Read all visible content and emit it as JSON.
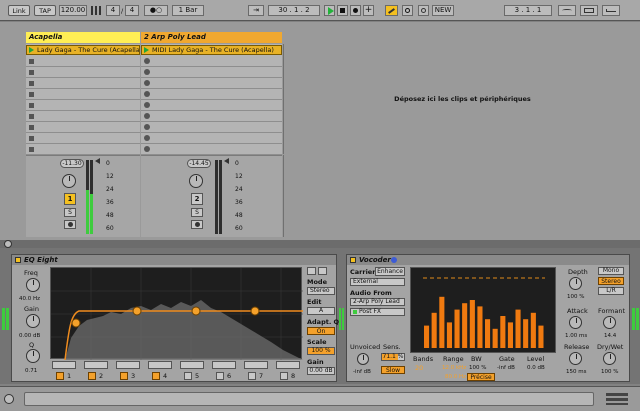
{
  "toolbar": {
    "link": "Link",
    "tap": "TAP",
    "tempo": "120.00",
    "sig_num": "4",
    "sig_den": "4",
    "metro": "●○",
    "quant": "1 Bar",
    "arrow": "⇥",
    "position": "30 . 1 . 2",
    "overdub_label": "NEW",
    "loop_pos": "3 . 1 . 1"
  },
  "tracks": [
    {
      "name": "Acapella",
      "clip": "Lady Gaga - The Cure (Acapella)",
      "volume": "-11.30",
      "number": "1",
      "solo": "S"
    },
    {
      "name": "2 Arp Poly Lead",
      "clip": "MIDI Lady Gaga - The Cure (Acapella)",
      "volume": "-14.45",
      "number": "2",
      "solo": "S"
    }
  ],
  "drop_zone": "Déposez ici les clips et périphériques",
  "meter_scale": [
    "0",
    "12",
    "24",
    "36",
    "48",
    "60"
  ],
  "eq": {
    "title": "EQ Eight",
    "freq_label": "Freq",
    "freq_value": "40.0 Hz",
    "gain_label": "Gain",
    "gain_value": "0.00 dB",
    "q_label": "Q",
    "q_value": "0.71",
    "mode_label": "Mode",
    "mode_value": "Stereo",
    "edit_label": "Edit",
    "edit_value": "A",
    "adapt_label": "Adapt. Q",
    "adapt_value": "On",
    "scale_label": "Scale",
    "scale_value": "100 %",
    "out_gain_label": "Gain",
    "out_gain_value": "0.00 dB",
    "bands": [
      "1",
      "2",
      "3",
      "4",
      "5",
      "6",
      "7",
      "8"
    ]
  },
  "vocoder": {
    "title": "Vocoder",
    "carrier_label": "Carrier",
    "enhance_label": "Enhance",
    "carrier_value": "External",
    "audio_from_label": "Audio From",
    "audio_from_value": "2-Arp Poly Lead",
    "post_fx": "Post FX",
    "unvoiced_label": "Unvoiced",
    "unvoiced_value": "-inf dB",
    "sens_label": "Sens.",
    "sens_value": "71.1 %",
    "slow_label": "Slow",
    "bands_label": "Bands",
    "bands_value": "20",
    "range_label": "Range",
    "range_value": "12.0 kHz",
    "range_low": "80.0 Hz",
    "bw_label": "BW",
    "bw_value": "100 %",
    "gate_label": "Gate",
    "gate_value": "-inf dB",
    "level_label": "Level",
    "level_value": "0.0 dB",
    "precise_label": "Précise",
    "depth_label": "Depth",
    "depth_value": "100 %",
    "attack_label": "Attack",
    "attack_value": "1.00 ms",
    "release_label": "Release",
    "release_value": "150 ms",
    "mono_label": "Mono",
    "stereo_label": "Stereo",
    "lr_label": "L/R",
    "formant_label": "Formant",
    "formant_value": "14.4",
    "drywet_label": "Dry/Wet",
    "drywet_value": "100 %",
    "band_levels": [
      0.35,
      0.55,
      0.8,
      0.4,
      0.6,
      0.7,
      0.75,
      0.65,
      0.45,
      0.3,
      0.5,
      0.4,
      0.6,
      0.45,
      0.55,
      0.35
    ]
  },
  "colors": {
    "clip": "#e8b226",
    "accent": "#f4a12b",
    "track1": "#ffee55",
    "track2": "#f0a830"
  }
}
